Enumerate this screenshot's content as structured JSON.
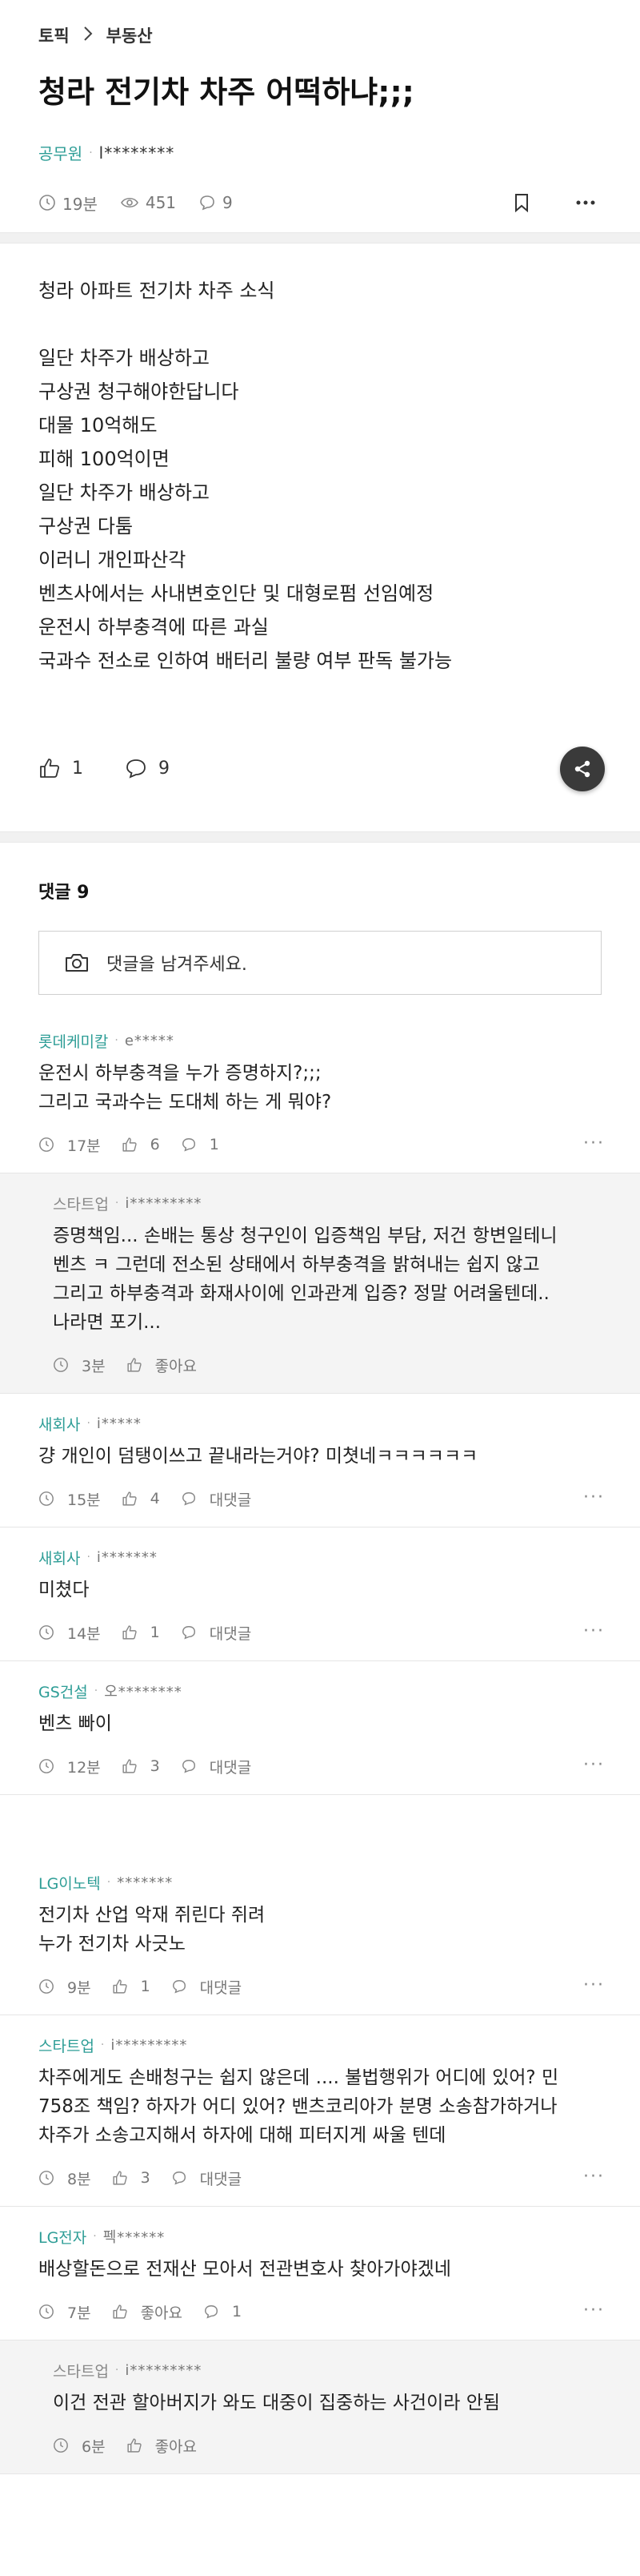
{
  "breadcrumb": {
    "topic": "토픽",
    "board": "부동산"
  },
  "post": {
    "title": "청라 전기차 차주 어떡하냐;;;",
    "company": "공무원",
    "nick": "l********",
    "time": "19분",
    "views": "451",
    "comments": "9",
    "body": [
      "청라 아파트 전기차 차주 소식",
      "",
      "일단 차주가 배상하고",
      "구상권 청구해야한답니다",
      "대물 10억해도",
      "피해 100억이면",
      "일단 차주가 배상하고",
      "구상권 다툼",
      "이러니 개인파산각",
      "벤츠사에서는 사내변호인단 및 대형로펌 선임예정",
      "운전시 하부충격에 따른 과실",
      "국과수 전소로 인하여 배터리 불량 여부 판독 불가능"
    ],
    "likes": "1",
    "comment_count": "9"
  },
  "comments_section": {
    "header": "댓글 9",
    "input_placeholder": "댓글을 남겨주세요."
  },
  "comments": [
    {
      "company": "롯데케미칼",
      "nick": "e*****",
      "text": "운전시 하부충격을 누가 증명하지?;;;\n그리고 국과수는 도대체 하는 게 뭐야?",
      "time": "17분",
      "likes": "6",
      "replies": "1",
      "reply": false
    },
    {
      "company": "스타트업",
      "nick": "i*********",
      "text": "증명책임... 손배는 통상 청구인이 입증책임 부담, 저건 항변일테니\n벤츠 ㅋ 그런데 전소된 상태에서 하부충격을 밝혀내는 쉽지 않고\n그리고 하부충격과 화재사이에 인과관계 입증? 정말 어려울텐데..\n나라면 포기...",
      "time": "3분",
      "likes": "좋아요",
      "replies": "",
      "reply": true
    },
    {
      "company": "새회사",
      "nick": "i*****",
      "text": "걍 개인이 덤탱이쓰고 끝내라는거야? 미쳣네ㅋㅋㅋㅋㅋㅋ",
      "time": "15분",
      "likes": "4",
      "replies": "대댓글",
      "reply": false
    },
    {
      "company": "새회사",
      "nick": "i*******",
      "text": "미쳤다",
      "time": "14분",
      "likes": "1",
      "replies": "대댓글",
      "reply": false
    },
    {
      "company": "GS건설",
      "nick": "오********",
      "text": "벤츠 빠이",
      "time": "12분",
      "likes": "3",
      "replies": "대댓글",
      "reply": false
    },
    {
      "company": "LG이노텍",
      "nick": "*******",
      "text": "전기차 산업 악재 쥐린다 쥐려\n누가 전기차 사긋노",
      "time": "9분",
      "likes": "1",
      "replies": "대댓글",
      "reply": false
    },
    {
      "company": "스타트업",
      "nick": "i*********",
      "text": "차주에게도 손배청구는 쉽지 않은데 .... 불법행위가 어디에 있어? 민\n758조 책임? 하자가 어디 있어? 밴츠코리아가 분명 소송참가하거나\n차주가 소송고지해서 하자에 대해 피터지게 싸울 텐데",
      "time": "8분",
      "likes": "3",
      "replies": "대댓글",
      "reply": false
    },
    {
      "company": "LG전자",
      "nick": "펙******",
      "text": "배상할돈으로 전재산 모아서 전관변호사 찾아가야겠네",
      "time": "7분",
      "likes": "좋아요",
      "replies": "1",
      "reply": false
    },
    {
      "company": "스타트업",
      "nick": "i*********",
      "text": "이건 전관 할아버지가 와도 대중이 집중하는 사건이라 안됨",
      "time": "6분",
      "likes": "좋아요",
      "replies": "",
      "reply": true
    }
  ]
}
